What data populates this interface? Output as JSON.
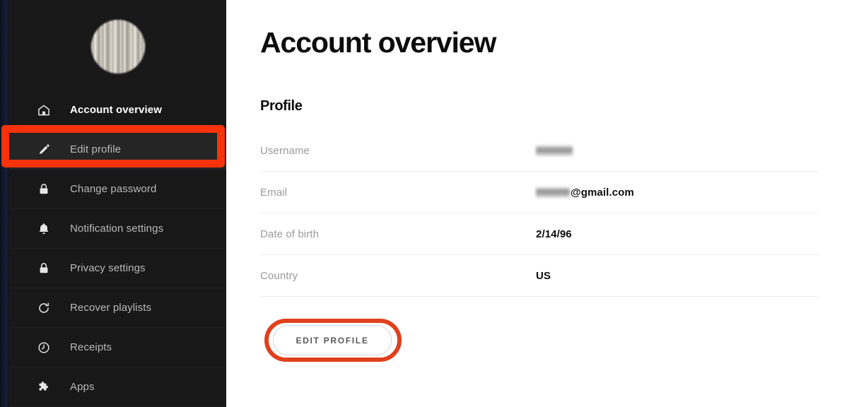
{
  "colors": {
    "sidebar_bg": "#181818",
    "active_indicator": "#2fd16b",
    "annotation_red": "#f8320a",
    "annotation_ellipse_red": "#e0401c",
    "text_muted": "#9a9a9a",
    "text_dark": "#0d0d0d"
  },
  "sidebar": {
    "avatar_alt": "profile-photo-blurred",
    "items": [
      {
        "label": "Account overview",
        "icon": "home-icon",
        "active": true,
        "hovered": false
      },
      {
        "label": "Edit profile",
        "icon": "pencil-icon",
        "active": false,
        "hovered": true
      },
      {
        "label": "Change password",
        "icon": "lock-icon",
        "active": false,
        "hovered": false
      },
      {
        "label": "Notification settings",
        "icon": "bell-icon",
        "active": false,
        "hovered": false
      },
      {
        "label": "Privacy settings",
        "icon": "lock-icon",
        "active": false,
        "hovered": false
      },
      {
        "label": "Recover playlists",
        "icon": "refresh-circle-icon",
        "active": false,
        "hovered": false
      },
      {
        "label": "Receipts",
        "icon": "clock-icon",
        "active": false,
        "hovered": false
      },
      {
        "label": "Apps",
        "icon": "puzzle-piece-icon",
        "active": false,
        "hovered": false
      }
    ]
  },
  "main": {
    "page_title": "Account overview",
    "section_title": "Profile",
    "rows": [
      {
        "label": "Username",
        "value": "",
        "redacted": true,
        "suffix": ""
      },
      {
        "label": "Email",
        "value": "",
        "redacted": true,
        "suffix": "@gmail.com"
      },
      {
        "label": "Date of birth",
        "value": "2/14/96",
        "redacted": false,
        "suffix": ""
      },
      {
        "label": "Country",
        "value": "US",
        "redacted": false,
        "suffix": ""
      }
    ],
    "edit_button_label": "EDIT PROFILE"
  },
  "annotations": [
    {
      "name": "edit-profile-nav-highlight",
      "shape": "rectangle"
    },
    {
      "name": "edit-profile-button-highlight",
      "shape": "ellipse"
    }
  ]
}
